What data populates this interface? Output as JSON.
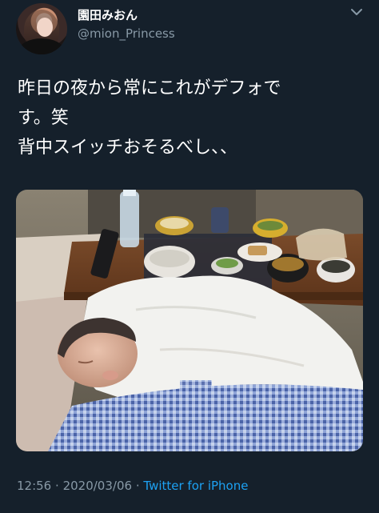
{
  "user": {
    "display_name": "園田みおん",
    "handle": "@mion_Princess",
    "avatar_icon": "profile-photo"
  },
  "tweet": {
    "lines": [
      "昨日の夜から常にこれがデフォで",
      "す。笑",
      "背中スイッチおそるべし、、"
    ]
  },
  "meta": {
    "time": "12:56",
    "separator": "·",
    "date": "2020/03/06",
    "source": "Twitter for iPhone"
  },
  "icons": {
    "more": "more-chevron-icon"
  },
  "colors": {
    "background": "#15202b",
    "secondary_text": "#8899a6",
    "link": "#1da1f2"
  }
}
